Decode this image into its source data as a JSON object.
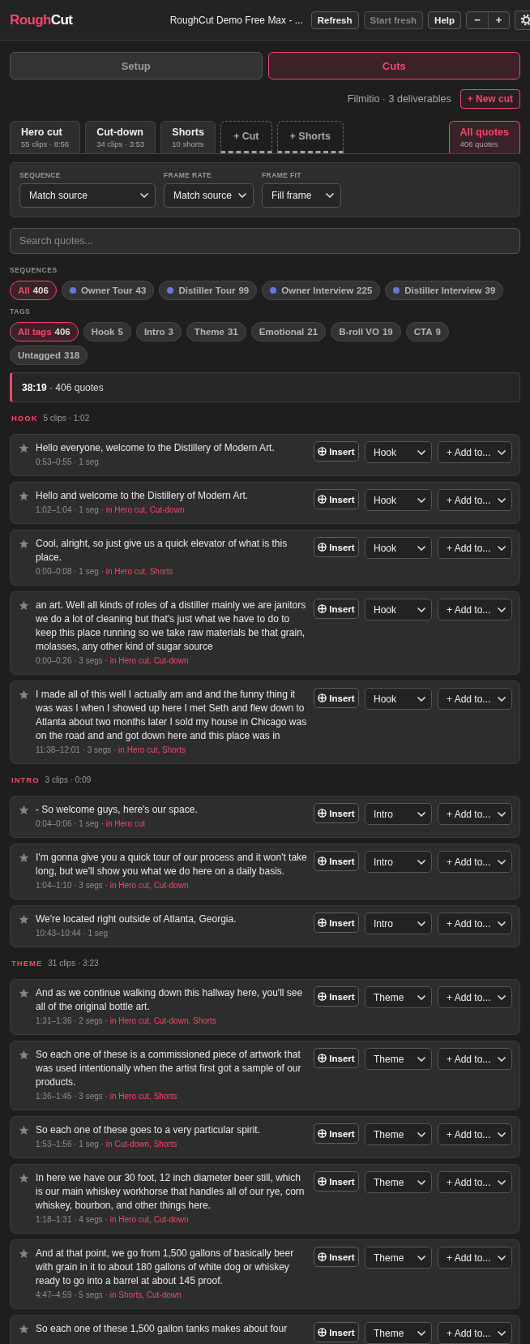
{
  "header": {
    "logo": {
      "accent": "Rough",
      "rest": "Cut"
    },
    "project_title": "RoughCut Demo Free Max - ...",
    "buttons": [
      {
        "label": "Refresh",
        "disabled": false
      },
      {
        "label": "Start fresh",
        "disabled": true
      },
      {
        "label": "Help",
        "disabled": false
      }
    ],
    "zoom_buttons": [
      "−",
      "+"
    ]
  },
  "mode_tabs": [
    {
      "label": "Setup",
      "selected": false
    },
    {
      "label": "Cuts",
      "selected": true
    }
  ],
  "deliverables": {
    "summary": "Filmitio · 3 deliverables",
    "new_cut_button": "+ New cut"
  },
  "cut_tabs": [
    {
      "kind": "cut",
      "title": "Hero cut",
      "subtitle": "55 clips · 8:56",
      "selected": false
    },
    {
      "kind": "cut",
      "title": "Cut-down",
      "subtitle": "34 clips · 3:53",
      "selected": false
    },
    {
      "kind": "cut",
      "title": "Shorts",
      "subtitle": "10 shorts",
      "selected": false
    },
    {
      "kind": "add",
      "title": "+ Cut",
      "selected": false
    },
    {
      "kind": "add",
      "title": "+ Shorts",
      "selected": false
    },
    {
      "kind": "all",
      "title": "All quotes",
      "subtitle": "406 quotes",
      "selected": true
    }
  ],
  "export_settings": [
    {
      "label": "SEQUENCE",
      "value": "Match source"
    },
    {
      "label": "FRAME RATE",
      "value": "Match source"
    },
    {
      "label": "FRAME FIT",
      "value": "Fill frame"
    }
  ],
  "search": {
    "placeholder": "Search quotes..."
  },
  "sequence_filter": {
    "label": "SEQUENCES",
    "chips": [
      {
        "kind": "all",
        "name": "All",
        "count": "406",
        "selected": true
      },
      {
        "kind": "sequence",
        "name": "Owner Tour",
        "count": "43",
        "selected": false
      },
      {
        "kind": "sequence",
        "name": "Distiller Tour",
        "count": "99",
        "selected": false
      },
      {
        "kind": "sequence",
        "name": "Owner Interview",
        "count": "225",
        "selected": false
      },
      {
        "kind": "sequence",
        "name": "Distiller Interview",
        "count": "39",
        "selected": false
      }
    ]
  },
  "tag_filter": {
    "label": "TAGS",
    "chips": [
      {
        "name": "All tags",
        "count": "406",
        "selected": true
      },
      {
        "name": "Hook",
        "count": "5",
        "selected": false
      },
      {
        "name": "Intro",
        "count": "3",
        "selected": false
      },
      {
        "name": "Theme",
        "count": "31",
        "selected": false
      },
      {
        "name": "Emotional",
        "count": "21",
        "selected": false
      },
      {
        "name": "B-roll VO",
        "count": "19",
        "selected": false
      },
      {
        "name": "CTA",
        "count": "9",
        "selected": false
      },
      {
        "name": "Untagged",
        "count": "318",
        "selected": false
      }
    ]
  },
  "summary": {
    "text": "**38:19** · 406 quotes"
  },
  "groups": [
    {
      "tag": "HOOK",
      "meta": "5 clips · 1:02",
      "quotes": [
        {
          "text": "Hello everyone, welcome to the Distillery of Modern Art.",
          "meta": "0:53–0:55 · 1 seg",
          "starred": false,
          "insert_button": "Insert",
          "tag": "Hook",
          "add_to": "+ Add to..."
        },
        {
          "text": "Hello and welcome to the Distillery of Modern Art.",
          "meta": "1:02–1:04 · 1 seg ·",
          "used_in": "in Hero cut, Cut-down",
          "starred": false,
          "insert_button": "Insert",
          "tag": "Hook",
          "add_to": "+ Add to..."
        },
        {
          "text": "Cool, alright, so just give us a quick elevator of what is this place.",
          "meta": "0:00–0:08 · 1 seg ·",
          "used_in": "in Hero cut, Shorts",
          "starred": false,
          "insert_button": "Insert",
          "tag": "Hook",
          "add_to": "+ Add to..."
        },
        {
          "text": "an art. Well all kinds of roles of a distiller mainly we are janitors we do a lot of cleaning but that's just what we have to do to keep this place running so we take raw materials be that grain, molasses, any other kind of sugar source",
          "meta": "0:00–0:26 · 3 segs ·",
          "used_in": "in Hero cut, Cut-down",
          "starred": false,
          "insert_button": "Insert",
          "tag": "Hook",
          "add_to": "+ Add to..."
        },
        {
          "text": "I made all of this well I actually am and and the funny thing it was was I when I showed up here I met Seth and flew down to Atlanta about two months later I sold my house in Chicago was on the road and and got down here and this place was in",
          "meta": "11:38–12:01 · 3 segs ·",
          "used_in": "in Hero cut, Shorts",
          "starred": false,
          "insert_button": "Insert",
          "tag": "Hook",
          "add_to": "+ Add to..."
        }
      ]
    },
    {
      "tag": "INTRO",
      "meta": "3 clips · 0:09",
      "quotes": [
        {
          "text": "- So welcome guys, here's our space.",
          "meta": "0:04–0:06 · 1 seg ·",
          "used_in": "in Hero cut",
          "starred": false,
          "insert_button": "Insert",
          "tag": "Intro",
          "add_to": "+ Add to..."
        },
        {
          "text": "I'm gonna give you a quick tour of our process and it won't take long, but we'll show you what we do here on a daily basis.",
          "meta": "1:04–1:10 · 3 segs ·",
          "used_in": "in Hero cut, Cut-down",
          "starred": false,
          "insert_button": "Insert",
          "tag": "Intro",
          "add_to": "+ Add to..."
        },
        {
          "text": "We're located right outside of Atlanta, Georgia.",
          "meta": "10:43–10:44 · 1 seg",
          "starred": false,
          "insert_button": "Insert",
          "tag": "Intro",
          "add_to": "+ Add to..."
        }
      ]
    },
    {
      "tag": "THEME",
      "meta": "31 clips · 3:23",
      "quotes": [
        {
          "text": "And as we continue walking down this hallway here, you'll see all of the original bottle art.",
          "meta": "1:31–1:36 · 2 segs ·",
          "used_in": "in Hero cut, Cut-down, Shorts",
          "starred": false,
          "insert_button": "Insert",
          "tag": "Theme",
          "add_to": "+ Add to..."
        },
        {
          "text": "So each one of these is a commissioned piece of artwork that was used intentionally when the artist first got a sample of our products.",
          "meta": "1:36–1:45 · 3 segs ·",
          "used_in": "in Hero cut, Shorts",
          "starred": false,
          "insert_button": "Insert",
          "tag": "Theme",
          "add_to": "+ Add to..."
        },
        {
          "text": "So each one of these goes to a very particular spirit.",
          "meta": "1:53–1:56 · 1 seg ·",
          "used_in": "in Cut-down, Shorts",
          "starred": false,
          "insert_button": "Insert",
          "tag": "Theme",
          "add_to": "+ Add to..."
        },
        {
          "text": "In here we have our 30 foot, 12 inch diameter beer still, which is our main whiskey workhorse that handles all of our rye, corn whiskey, bourbon, and other things here.",
          "meta": "1:18–1:31 · 4 segs ·",
          "used_in": "in Hero cut, Cut-down",
          "starred": false,
          "insert_button": "Insert",
          "tag": "Theme",
          "add_to": "+ Add to..."
        },
        {
          "text": "And at that point, we go from 1,500 gallons of basically beer with grain in it to about 180 gallons of white dog or whiskey ready to go into a barrel at about 145 proof.",
          "meta": "4:47–4:59 · 5 segs ·",
          "used_in": "in Shorts, Cut-down",
          "starred": false,
          "insert_button": "Insert",
          "tag": "Theme",
          "add_to": "+ Add to..."
        },
        {
          "text": "So each one of these 1,500 gallon tanks makes about four",
          "starred": false,
          "insert_button": "Insert",
          "tag": "Theme",
          "add_to": "+ Add to..."
        }
      ]
    }
  ]
}
